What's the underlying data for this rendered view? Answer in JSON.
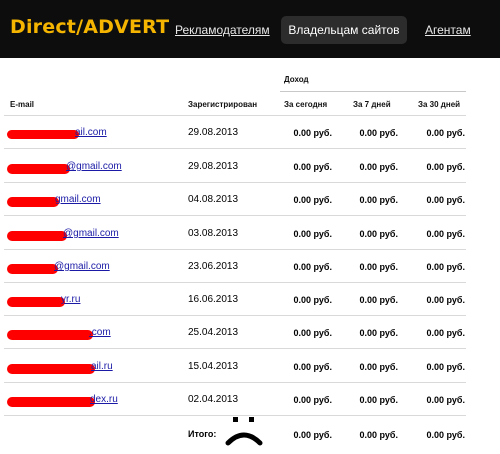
{
  "header": {
    "brand": "Direct/ADVERT",
    "nav": {
      "advertisers": "Рекламодателям",
      "site_owners": "Владельцам сайтов",
      "agents": "Агентам"
    }
  },
  "table": {
    "group_header": "Доход",
    "columns": {
      "email": "E-mail",
      "registered": "Зарегистрирован",
      "today": "За сегодня",
      "days7": "За 7 дней",
      "days30": "За 30 дней"
    },
    "rows": [
      {
        "email_visible": "ail.com",
        "registered": "29.08.2013",
        "today": "0.00 руб.",
        "days7": "0.00 руб.",
        "days30": "0.00 руб."
      },
      {
        "email_visible": "@gmail.com",
        "registered": "29.08.2013",
        "today": "0.00 руб.",
        "days7": "0.00 руб.",
        "days30": "0.00 руб."
      },
      {
        "email_visible": "gmail.com",
        "registered": "04.08.2013",
        "today": "0.00 руб.",
        "days7": "0.00 руб.",
        "days30": "0.00 руб."
      },
      {
        "email_visible": "@gmail.com",
        "registered": "03.08.2013",
        "today": "0.00 руб.",
        "days7": "0.00 руб.",
        "days30": "0.00 руб."
      },
      {
        "email_visible": "@gmail.com",
        "registered": "23.06.2013",
        "today": "0.00 руб.",
        "days7": "0.00 руб.",
        "days30": "0.00 руб."
      },
      {
        "email_visible": "yr.ru",
        "registered": "16.06.2013",
        "today": "0.00 руб.",
        "days7": "0.00 руб.",
        "days30": "0.00 руб."
      },
      {
        "email_visible": ".com",
        "registered": "25.04.2013",
        "today": "0.00 руб.",
        "days7": "0.00 руб.",
        "days30": "0.00 руб."
      },
      {
        "email_visible": "ail.ru",
        "registered": "15.04.2013",
        "today": "0.00 руб.",
        "days7": "0.00 руб.",
        "days30": "0.00 руб."
      },
      {
        "email_visible": "dex.ru",
        "registered": "02.04.2013",
        "today": "0.00 руб.",
        "days7": "0.00 руб.",
        "days30": "0.00 руб."
      }
    ],
    "total": {
      "label": "Итого:",
      "today": "0.00 руб.",
      "days7": "0.00 руб.",
      "days30": "0.00 руб."
    }
  },
  "colors": {
    "brand": "#f5b400",
    "redaction": "#ff0000",
    "link": "#1a1aa6"
  },
  "icons": {
    "face": "sad-face-icon"
  }
}
